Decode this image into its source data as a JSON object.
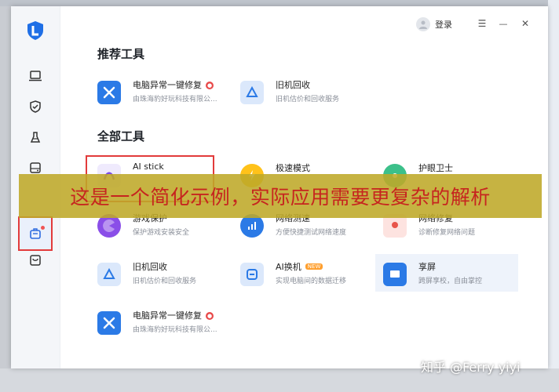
{
  "window": {
    "login_label": "登录",
    "controls": {
      "menu": "☰",
      "minimize": "—",
      "close": "✕"
    }
  },
  "sidebar": {
    "items": [
      {
        "icon": "laptop-icon"
      },
      {
        "icon": "shield-check-icon"
      },
      {
        "icon": "clean-brush-icon"
      },
      {
        "icon": "drive-icon"
      },
      {
        "icon": "toolbox-icon",
        "active": true
      },
      {
        "icon": "bag-icon"
      }
    ]
  },
  "sections": {
    "recommended_title": "推荐工具",
    "all_title": "全部工具"
  },
  "recommended_tools": [
    {
      "name": "电脑异常一键修复",
      "desc": "由珠海豹好玩科技有限公...",
      "icon": "wrench-screwdriver-icon",
      "badge": "red"
    },
    {
      "name": "旧机回收",
      "desc": "旧机估价和回收服务",
      "icon": "recycle-icon"
    }
  ],
  "all_tools": [
    {
      "name": "AI stick",
      "desc": "",
      "icon": "ai-stick-icon"
    },
    {
      "name": "极速模式",
      "desc": "",
      "icon": "lightning-icon"
    },
    {
      "name": "护眼卫士",
      "desc": "",
      "icon": "eye-shield-icon"
    },
    {
      "name": "游戏保护",
      "desc": "保护游戏安装安全",
      "icon": "game-icon"
    },
    {
      "name": "网络测速",
      "desc": "方便快捷测试网络速度",
      "icon": "speed-icon"
    },
    {
      "name": "网络修复",
      "desc": "诊断修复网络问题",
      "icon": "network-repair-icon"
    },
    {
      "name": "旧机回收",
      "desc": "旧机估价和回收服务",
      "icon": "recycle-icon"
    },
    {
      "name": "AI换机",
      "desc": "实现电脑间的数据迁移",
      "icon": "ai-transfer-icon",
      "badge": "NEW"
    },
    {
      "name": "享屏",
      "desc": "跨屏享校，自由掌控",
      "icon": "share-screen-icon"
    },
    {
      "name": "电脑异常一键修复",
      "desc": "由珠海豹好玩科技有限公...",
      "icon": "wrench-screwdriver-icon",
      "badge": "red"
    }
  ],
  "overlay_caption": "这是一个简化示例，实际应用需要更复杂的解析",
  "watermark": "知乎 @Ferry yiyi",
  "colors": {
    "accent": "#3b7cf0",
    "highlight": "#e23b3b",
    "overlay": "#bea828"
  }
}
